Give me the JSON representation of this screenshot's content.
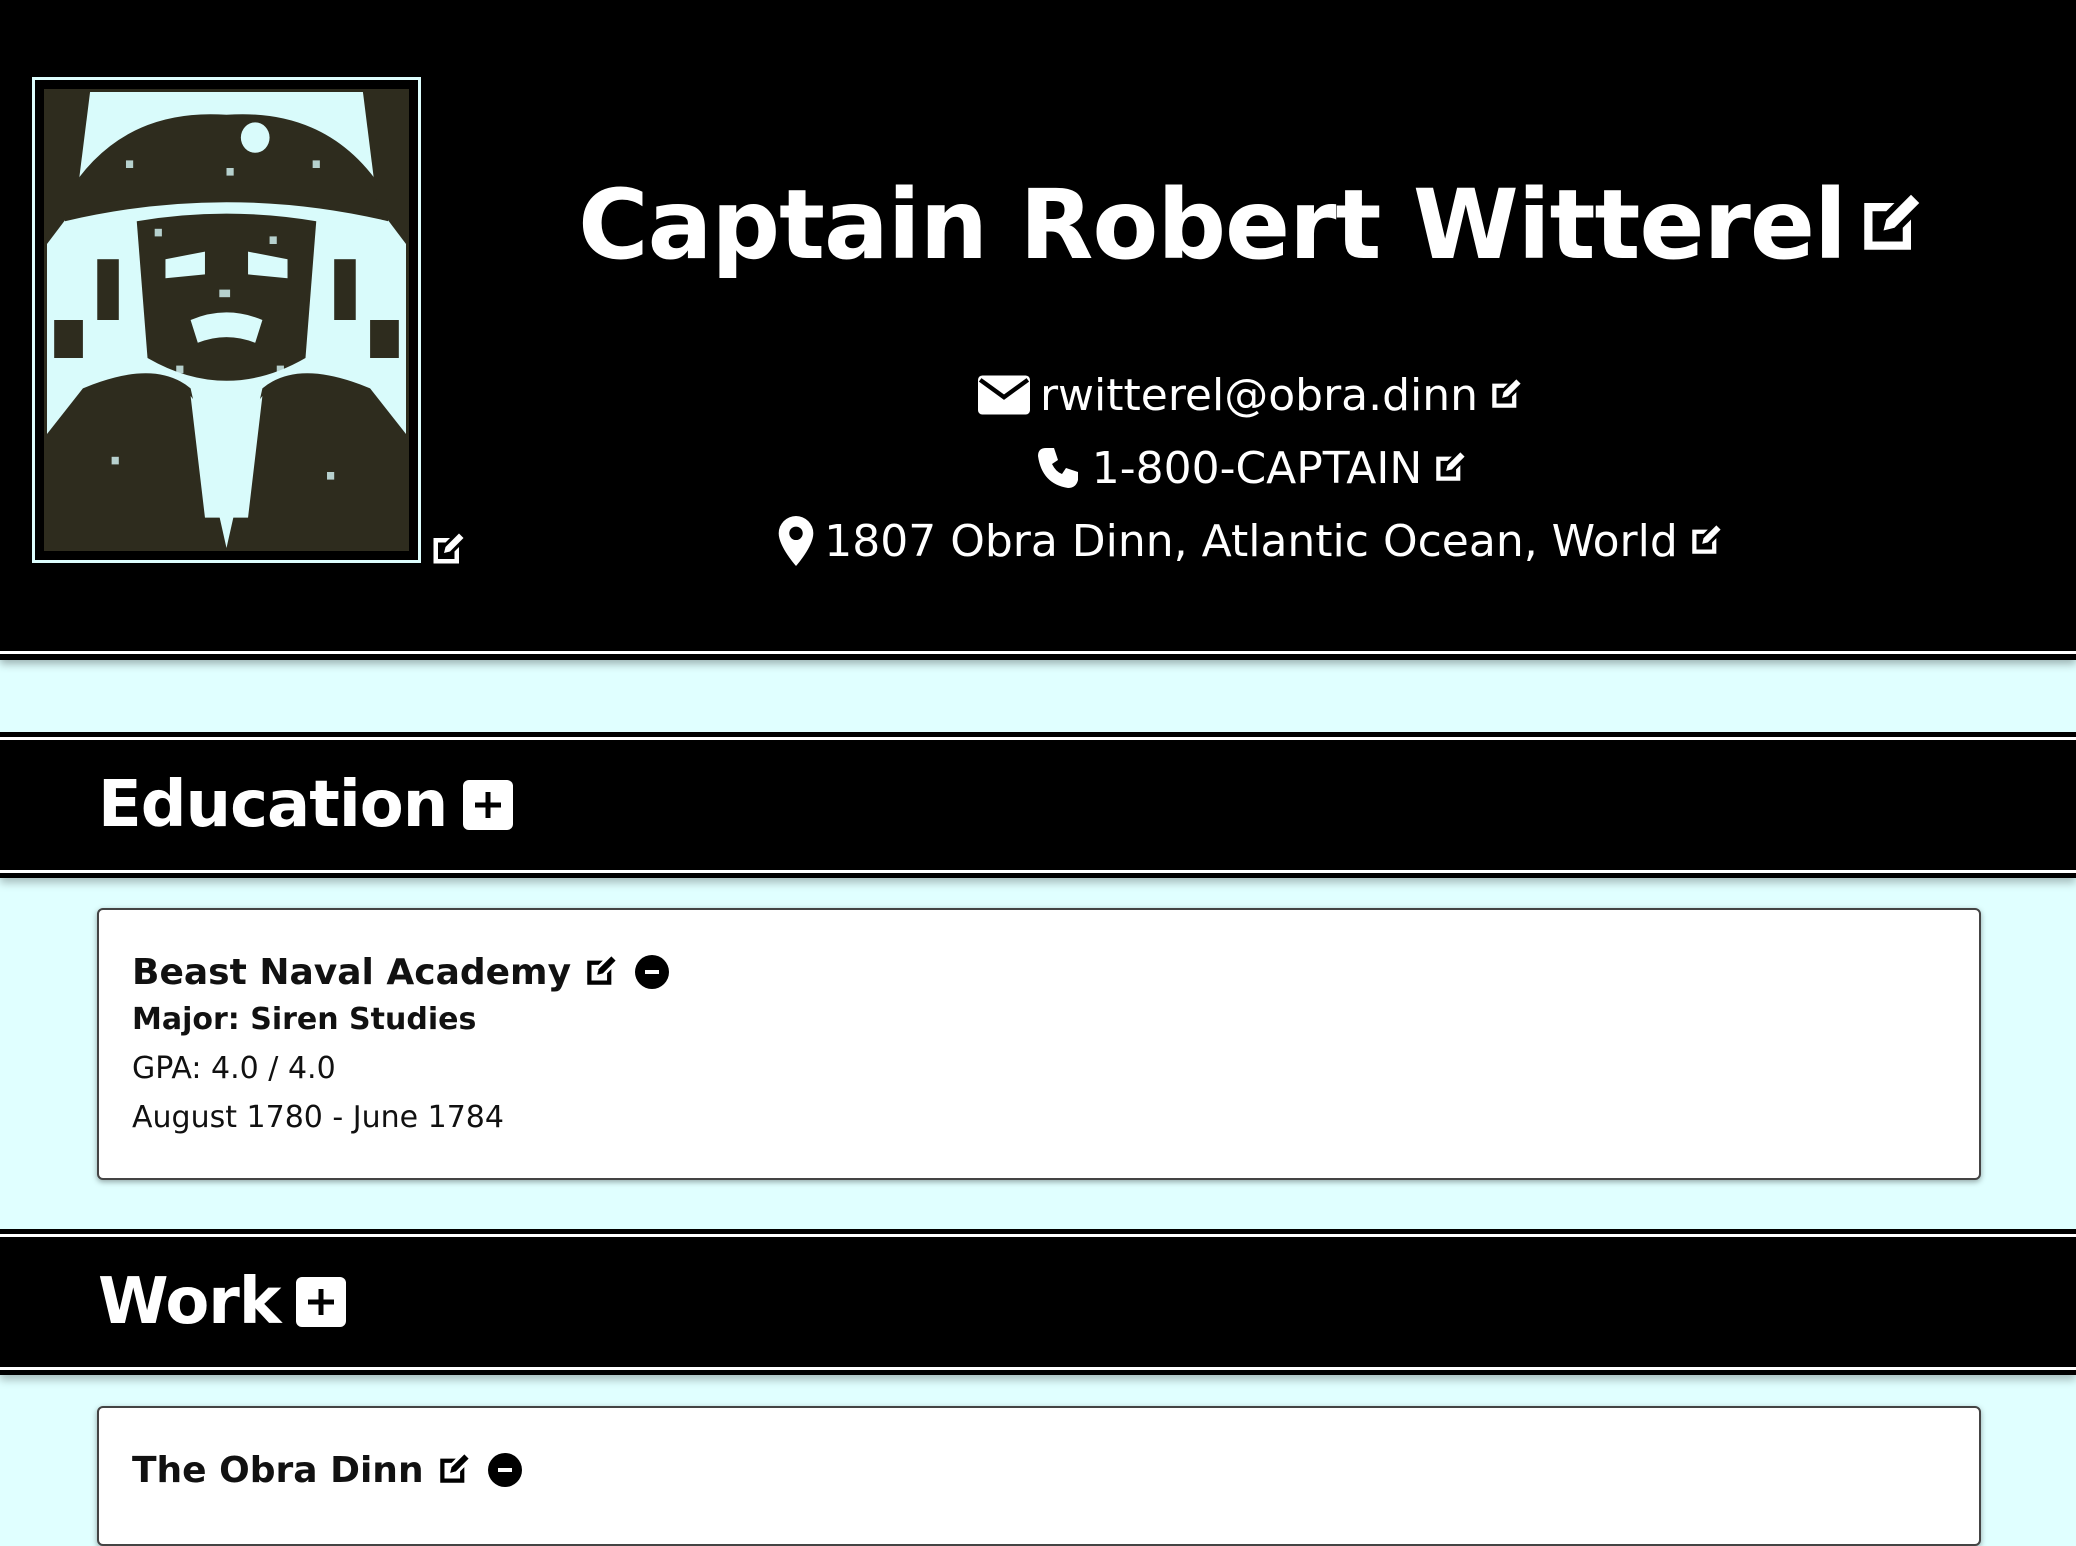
{
  "profile": {
    "name": "Captain Robert Witterel",
    "email": "rwitterel@obra.dinn",
    "phone": "1-800-CAPTAIN",
    "address": "1807 Obra Dinn, Atlantic Ocean, World"
  },
  "sections": {
    "education": {
      "title": "Education",
      "entries": [
        {
          "school": "Beast Naval Academy",
          "major": "Major: Siren Studies",
          "gpa": "GPA: 4.0 / 4.0",
          "dates": "August 1780 - June 1784"
        }
      ]
    },
    "work": {
      "title": "Work",
      "entries": [
        {
          "company": "The Obra Dinn"
        }
      ]
    }
  },
  "colors": {
    "background": "#e0ffff",
    "bars": "#000000",
    "portrait_dark": "#2e2c1e",
    "portrait_light": "#d9fbfb"
  },
  "icons": [
    "edit-icon",
    "envelope-icon",
    "phone-icon",
    "map-pin-icon",
    "plus-square-icon",
    "minus-circle-icon"
  ]
}
